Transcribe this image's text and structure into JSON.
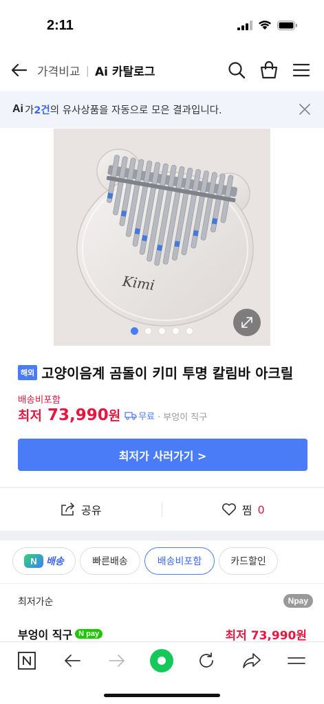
{
  "status": {
    "time": "2:11"
  },
  "nav": {
    "crumb": "가격비교",
    "brand": "Ai 카탈로그"
  },
  "banner": {
    "logo": "Ai",
    "prefix": "가 ",
    "count": "2건",
    "suffix": "의 유사상품을 자동으로 모은 결과입니다."
  },
  "gallery": {
    "image_count": 5,
    "active_index": 0
  },
  "product": {
    "badge": "해외",
    "title": "고양이음계 곰돌이 키미 투명 칼림바 아크릴",
    "shipping_label": "배송비포함",
    "price_prefix": "최저",
    "price": "73,990",
    "price_unit": "원",
    "free_shipping": "무료",
    "seller": "부엉이 직구"
  },
  "buy_button": {
    "label": "최저가 사러가기 >"
  },
  "actions": {
    "share": "공유",
    "like": "찜",
    "like_count": "0"
  },
  "filters": [
    {
      "label": "배송",
      "badge": "N"
    },
    {
      "label": "빠른배송"
    },
    {
      "label": "배송비포함",
      "selected": true
    },
    {
      "label": "카드할인"
    }
  ],
  "sort": {
    "label": "최저가순",
    "npay": "Npay"
  },
  "listing": {
    "seller": "부엉이 직구",
    "npay": "N pay",
    "price": "최저 73,990원"
  },
  "colors": {
    "accent": "#4a7cf7",
    "price": "#e5173f",
    "banner_bg": "#f1f4fb"
  }
}
